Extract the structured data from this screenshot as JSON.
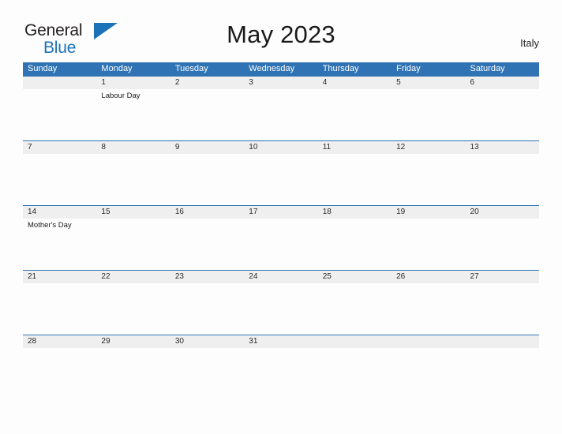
{
  "brand": {
    "name_part1": "General",
    "name_part2": "Blue",
    "flag_icon": "flag-triangle-icon"
  },
  "header": {
    "title": "May 2023",
    "country": "Italy"
  },
  "colors": {
    "header_blue": "#2f73b4",
    "brand_blue": "#1b72b8",
    "date_band": "#efefef",
    "page_background": "#fdfdfd",
    "text": "#1a1a1a"
  },
  "calendar": {
    "weekdays": [
      "Sunday",
      "Monday",
      "Tuesday",
      "Wednesday",
      "Thursday",
      "Friday",
      "Saturday"
    ],
    "weeks": [
      {
        "days": [
          {
            "date": "",
            "event": ""
          },
          {
            "date": "1",
            "event": "Labour Day"
          },
          {
            "date": "2",
            "event": ""
          },
          {
            "date": "3",
            "event": ""
          },
          {
            "date": "4",
            "event": ""
          },
          {
            "date": "5",
            "event": ""
          },
          {
            "date": "6",
            "event": ""
          }
        ]
      },
      {
        "days": [
          {
            "date": "7",
            "event": ""
          },
          {
            "date": "8",
            "event": ""
          },
          {
            "date": "9",
            "event": ""
          },
          {
            "date": "10",
            "event": ""
          },
          {
            "date": "11",
            "event": ""
          },
          {
            "date": "12",
            "event": ""
          },
          {
            "date": "13",
            "event": ""
          }
        ]
      },
      {
        "days": [
          {
            "date": "14",
            "event": "Mother's Day"
          },
          {
            "date": "15",
            "event": ""
          },
          {
            "date": "16",
            "event": ""
          },
          {
            "date": "17",
            "event": ""
          },
          {
            "date": "18",
            "event": ""
          },
          {
            "date": "19",
            "event": ""
          },
          {
            "date": "20",
            "event": ""
          }
        ]
      },
      {
        "days": [
          {
            "date": "21",
            "event": ""
          },
          {
            "date": "22",
            "event": ""
          },
          {
            "date": "23",
            "event": ""
          },
          {
            "date": "24",
            "event": ""
          },
          {
            "date": "25",
            "event": ""
          },
          {
            "date": "26",
            "event": ""
          },
          {
            "date": "27",
            "event": ""
          }
        ]
      },
      {
        "days": [
          {
            "date": "28",
            "event": ""
          },
          {
            "date": "29",
            "event": ""
          },
          {
            "date": "30",
            "event": ""
          },
          {
            "date": "31",
            "event": ""
          },
          {
            "date": "",
            "event": ""
          },
          {
            "date": "",
            "event": ""
          },
          {
            "date": "",
            "event": ""
          }
        ]
      }
    ]
  }
}
